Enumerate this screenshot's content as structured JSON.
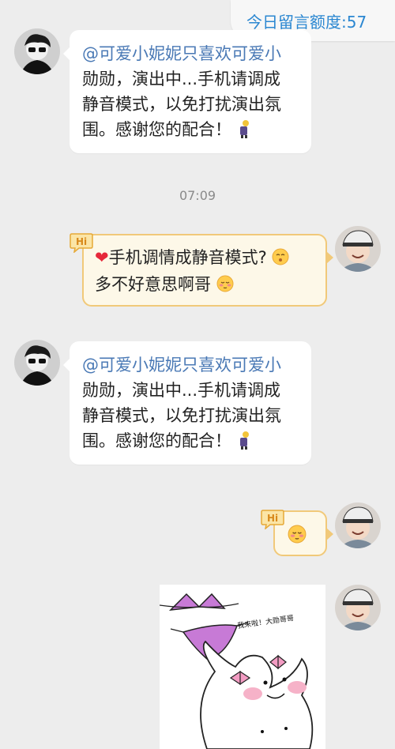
{
  "quota": {
    "label": "今日留言额度:57"
  },
  "messages": [
    {
      "mention": "@可爱小妮妮只喜欢可爱小",
      "lines": [
        "勋勋，演出中...手机请调成",
        "静音模式，以免打扰演出氛",
        "围。感谢您的配合！"
      ]
    },
    {
      "time": "07:09"
    },
    {
      "line1": "手机调情成静音模式?",
      "line2": "多不好意思啊哥"
    },
    {
      "mention": "@可爱小妮妮只喜欢可爱小",
      "lines": [
        "勋勋，演出中...手机请调成",
        "静音模式，以免打扰演出氛",
        "围。感谢您的配合！"
      ]
    },
    {
      "image_caption": "我来啦！大勋哥哥"
    }
  ],
  "badges": {
    "hi": "Hi"
  },
  "icons": {
    "heart": "heart-icon",
    "blush": "blush-emoji-icon",
    "shy": "shy-emoji-icon",
    "sticker": "mascot-sticker-icon"
  }
}
